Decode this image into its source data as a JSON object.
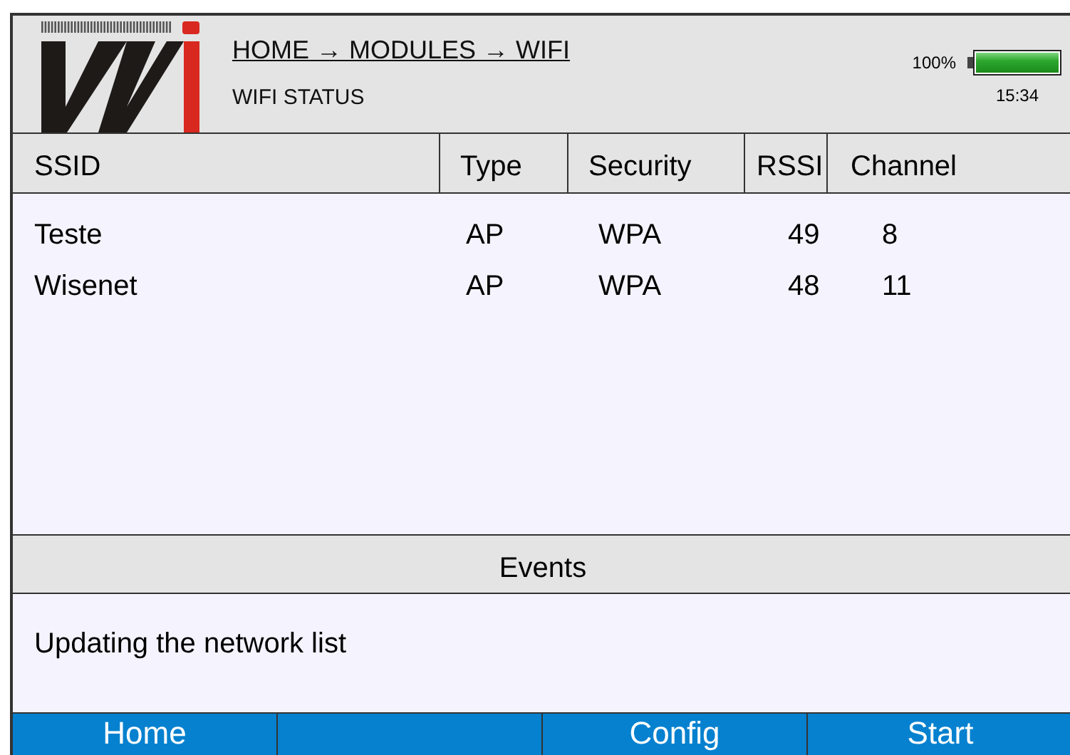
{
  "header": {
    "breadcrumb": "HOME → MODULES → WIFI",
    "title": "WIFI STATUS",
    "battery": {
      "percent": "100%",
      "level": 1
    },
    "time": "15:34"
  },
  "table": {
    "columns": [
      "SSID",
      "Type",
      "Security",
      "RSSI",
      "Channel"
    ],
    "rows": [
      [
        "Teste",
        "AP",
        "WPA",
        "49",
        "8"
      ],
      [
        "Wisenet",
        "AP",
        "WPA",
        "48",
        "11"
      ]
    ]
  },
  "events": {
    "title": "Events",
    "message": "Updating the network list"
  },
  "buttons": [
    {
      "kind": "text",
      "label": "Home"
    },
    {
      "kind": "empty"
    },
    {
      "kind": "text",
      "label": "Config"
    },
    {
      "kind": "text",
      "label": "Start"
    }
  ]
}
